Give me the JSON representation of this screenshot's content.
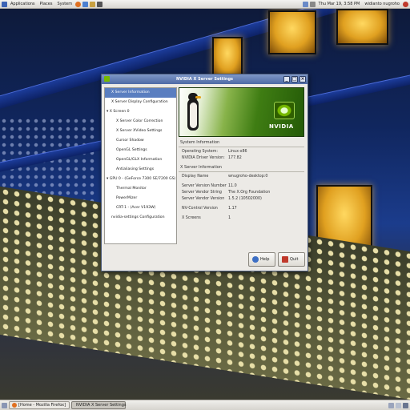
{
  "top_panel": {
    "applications": "Applications",
    "places": "Places",
    "system": "System",
    "clock": "Thu Mar 19,  3:58 PM",
    "user": "widianto nugroho"
  },
  "window": {
    "title": "NVIDIA X Server Settings",
    "tree": [
      "X Server Information",
      "X Server Display Configuration",
      "X Screen 0",
      "X Server Color Correction",
      "X Server XVideo Settings",
      "Cursor Shadow",
      "OpenGL Settings",
      "OpenGL/GLX Information",
      "Antialiasing Settings",
      "GPU 0 - (GeForce 7300 SE/7200 GS)",
      "Thermal Monitor",
      "PowerMizer",
      "CRT-1 - (Acer V193W)",
      "nvidia-settings Configuration"
    ],
    "banner_logo": "NVIDIA",
    "system_info": {
      "heading": "System Information",
      "os_label": "Operating System:",
      "os_value": "Linux-x86",
      "driver_label": "NVIDIA Driver Version:",
      "driver_value": "177.82"
    },
    "xserver_info": {
      "heading": "X Server Information",
      "display_name_label": "Display Name",
      "display_name_value": "wnugroho-desktop:0",
      "version_label": "Server Version Number",
      "version_value": "11.0",
      "vendor_label": "Server Vendor String",
      "vendor_value": "The X.Org Foundation",
      "vendor_version_label": "Server Vendor Version",
      "vendor_version_value": "1.5.2 (10502000)",
      "nv_control_label": "NV-Control Version",
      "nv_control_value": "1.17",
      "screens_label": "X Screens",
      "screens_value": "1"
    },
    "help_label": "Help",
    "quit_label": "Quit"
  },
  "taskbar": {
    "firefox": "[Home - Mozilla Firefox]",
    "nvidia": "NVIDIA X Server Settings"
  },
  "colors": {
    "nvidia_green": "#76b900",
    "selection": "#5a7ec0",
    "titlebar": "#5b76b0"
  }
}
